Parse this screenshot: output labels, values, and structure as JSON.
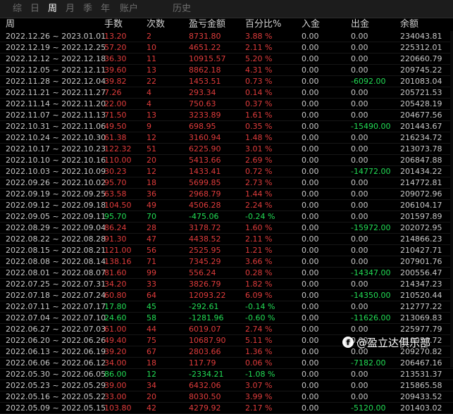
{
  "tabs": [
    {
      "label": "综"
    },
    {
      "label": "日"
    },
    {
      "label": "周",
      "active": true
    },
    {
      "label": "月"
    },
    {
      "label": "季"
    },
    {
      "label": "年"
    },
    {
      "label": "账户"
    },
    {
      "label": "历史"
    }
  ],
  "columns": {
    "week": "周",
    "hands": "手数",
    "count": "次数",
    "pnl": "盈亏金额",
    "pct": "百分比%",
    "deposit": "入金",
    "withdraw": "出金",
    "balance": "余额"
  },
  "colors": {
    "positive": "#e03c3c",
    "negative": "#22dd55",
    "neutral": "#c8c8c8"
  },
  "rows": [
    {
      "week": "2022.12.26 ~ 2023.01.01",
      "hands": "13.20",
      "count": "2",
      "pnl": "8731.80",
      "pct": "3.88 %",
      "deposit": "0.00",
      "withdraw": "0.00",
      "balance": "234043.81"
    },
    {
      "week": "2022.12.19 ~ 2022.12.25",
      "hands": "57.20",
      "count": "10",
      "pnl": "4651.22",
      "pct": "2.11 %",
      "deposit": "0.00",
      "withdraw": "0.00",
      "balance": "225312.01"
    },
    {
      "week": "2022.12.12 ~ 2022.12.18",
      "hands": "36.30",
      "count": "11",
      "pnl": "10915.57",
      "pct": "5.20 %",
      "deposit": "0.00",
      "withdraw": "0.00",
      "balance": "220660.79"
    },
    {
      "week": "2022.12.05 ~ 2022.12.11",
      "hands": "39.60",
      "count": "13",
      "pnl": "8862.18",
      "pct": "4.31 %",
      "deposit": "0.00",
      "withdraw": "0.00",
      "balance": "209745.22"
    },
    {
      "week": "2022.11.28 ~ 2022.12.04",
      "hands": "39.82",
      "count": "22",
      "pnl": "1453.51",
      "pct": "0.73 %",
      "deposit": "0.00",
      "withdraw": "-6092.00",
      "balance": "201083.04"
    },
    {
      "week": "2022.11.21 ~ 2022.11.27",
      "hands": "7.26",
      "count": "4",
      "pnl": "293.34",
      "pct": "0.14 %",
      "deposit": "0.00",
      "withdraw": "0.00",
      "balance": "205721.53"
    },
    {
      "week": "2022.11.14 ~ 2022.11.20",
      "hands": "22.00",
      "count": "4",
      "pnl": "750.63",
      "pct": "0.37 %",
      "deposit": "0.00",
      "withdraw": "0.00",
      "balance": "205428.19"
    },
    {
      "week": "2022.11.07 ~ 2022.11.13",
      "hands": "71.50",
      "count": "13",
      "pnl": "3233.89",
      "pct": "1.61 %",
      "deposit": "0.00",
      "withdraw": "0.00",
      "balance": "204677.56"
    },
    {
      "week": "2022.10.31 ~ 2022.11.06",
      "hands": "49.50",
      "count": "9",
      "pnl": "698.95",
      "pct": "0.35 %",
      "deposit": "0.00",
      "withdraw": "-15490.00",
      "balance": "201443.67"
    },
    {
      "week": "2022.10.24 ~ 2022.10.30",
      "hands": "61.38",
      "count": "12",
      "pnl": "3160.94",
      "pct": "1.48 %",
      "deposit": "0.00",
      "withdraw": "0.00",
      "balance": "216234.72"
    },
    {
      "week": "2022.10.17 ~ 2022.10.23",
      "hands": "122.32",
      "count": "51",
      "pnl": "6225.90",
      "pct": "3.01 %",
      "deposit": "0.00",
      "withdraw": "0.00",
      "balance": "213073.78"
    },
    {
      "week": "2022.10.10 ~ 2022.10.16",
      "hands": "110.00",
      "count": "20",
      "pnl": "5413.66",
      "pct": "2.69 %",
      "deposit": "0.00",
      "withdraw": "0.00",
      "balance": "206847.88"
    },
    {
      "week": "2022.10.03 ~ 2022.10.09",
      "hands": "30.23",
      "count": "12",
      "pnl": "1433.41",
      "pct": "0.72 %",
      "deposit": "0.00",
      "withdraw": "-14772.00",
      "balance": "201434.22"
    },
    {
      "week": "2022.09.26 ~ 2022.10.02",
      "hands": "95.70",
      "count": "18",
      "pnl": "5699.85",
      "pct": "2.73 %",
      "deposit": "0.00",
      "withdraw": "0.00",
      "balance": "214772.81"
    },
    {
      "week": "2022.09.19 ~ 2022.09.25",
      "hands": "63.58",
      "count": "36",
      "pnl": "2968.79",
      "pct": "1.44 %",
      "deposit": "0.00",
      "withdraw": "0.00",
      "balance": "209072.96"
    },
    {
      "week": "2022.09.12 ~ 2022.09.18",
      "hands": "104.50",
      "count": "49",
      "pnl": "4506.28",
      "pct": "2.24 %",
      "deposit": "0.00",
      "withdraw": "0.00",
      "balance": "206104.17"
    },
    {
      "week": "2022.09.05 ~ 2022.09.11",
      "hands": "95.70",
      "count": "70",
      "pnl": "-475.06",
      "pct": "-0.24 %",
      "deposit": "0.00",
      "withdraw": "0.00",
      "balance": "201597.89"
    },
    {
      "week": "2022.08.29 ~ 2022.09.04",
      "hands": "86.24",
      "count": "28",
      "pnl": "3178.72",
      "pct": "1.60 %",
      "deposit": "0.00",
      "withdraw": "-15972.00",
      "balance": "202072.95"
    },
    {
      "week": "2022.08.22 ~ 2022.08.28",
      "hands": "91.30",
      "count": "47",
      "pnl": "4438.52",
      "pct": "2.11 %",
      "deposit": "0.00",
      "withdraw": "0.00",
      "balance": "214866.23"
    },
    {
      "week": "2022.08.15 ~ 2022.08.21",
      "hands": "121.00",
      "count": "56",
      "pnl": "2525.95",
      "pct": "1.21 %",
      "deposit": "0.00",
      "withdraw": "0.00",
      "balance": "210427.71"
    },
    {
      "week": "2022.08.08 ~ 2022.08.14",
      "hands": "138.16",
      "count": "71",
      "pnl": "7345.29",
      "pct": "3.66 %",
      "deposit": "0.00",
      "withdraw": "0.00",
      "balance": "207901.76"
    },
    {
      "week": "2022.08.01 ~ 2022.08.07",
      "hands": "81.60",
      "count": "99",
      "pnl": "556.24",
      "pct": "0.28 %",
      "deposit": "0.00",
      "withdraw": "-14347.00",
      "balance": "200556.47"
    },
    {
      "week": "2022.07.25 ~ 2022.07.31",
      "hands": "34.20",
      "count": "33",
      "pnl": "3826.79",
      "pct": "1.82 %",
      "deposit": "0.00",
      "withdraw": "0.00",
      "balance": "214347.23"
    },
    {
      "week": "2022.07.18 ~ 2022.07.24",
      "hands": "60.80",
      "count": "64",
      "pnl": "12093.22",
      "pct": "6.09 %",
      "deposit": "0.00",
      "withdraw": "-14350.00",
      "balance": "210520.44"
    },
    {
      "week": "2022.07.11 ~ 2022.07.17",
      "hands": "17.80",
      "count": "45",
      "pnl": "-292.61",
      "pct": "-0.14 %",
      "deposit": "0.00",
      "withdraw": "0.00",
      "balance": "212777.22"
    },
    {
      "week": "2022.07.04 ~ 2022.07.10",
      "hands": "24.60",
      "count": "58",
      "pnl": "-1281.96",
      "pct": "-0.60 %",
      "deposit": "0.00",
      "withdraw": "-11626.00",
      "balance": "213069.83"
    },
    {
      "week": "2022.06.27 ~ 2022.07.03",
      "hands": "61.00",
      "count": "44",
      "pnl": "6019.07",
      "pct": "2.74 %",
      "deposit": "0.00",
      "withdraw": "0.00",
      "balance": "225977.79"
    },
    {
      "week": "2022.06.20 ~ 2022.06.26",
      "hands": "49.40",
      "count": "75",
      "pnl": "10687.90",
      "pct": "5.11 %",
      "deposit": "0.00",
      "withdraw": "0.00",
      "balance": "219958.72"
    },
    {
      "week": "2022.06.13 ~ 2022.06.19",
      "hands": "39.20",
      "count": "67",
      "pnl": "2803.66",
      "pct": "1.36 %",
      "deposit": "0.00",
      "withdraw": "0.00",
      "balance": "209270.82"
    },
    {
      "week": "2022.06.06 ~ 2022.06.12",
      "hands": "34.00",
      "count": "18",
      "pnl": "117.79",
      "pct": "0.06 %",
      "deposit": "0.00",
      "withdraw": "-7182.00",
      "balance": "206467.16"
    },
    {
      "week": "2022.05.30 ~ 2022.06.05",
      "hands": "86.00",
      "count": "12",
      "pnl": "-2334.21",
      "pct": "-1.08 %",
      "deposit": "0.00",
      "withdraw": "0.00",
      "balance": "213531.37"
    },
    {
      "week": "2022.05.23 ~ 2022.05.29",
      "hands": "39.00",
      "count": "34",
      "pnl": "6432.06",
      "pct": "3.07 %",
      "deposit": "0.00",
      "withdraw": "0.00",
      "balance": "215865.58"
    },
    {
      "week": "2022.05.16 ~ 2022.05.22",
      "hands": "33.00",
      "count": "20",
      "pnl": "8030.50",
      "pct": "3.99 %",
      "deposit": "0.00",
      "withdraw": "0.00",
      "balance": "209433.52"
    },
    {
      "week": "2022.05.09 ~ 2022.05.15",
      "hands": "103.80",
      "count": "42",
      "pnl": "4279.92",
      "pct": "2.17 %",
      "deposit": "0.00",
      "withdraw": "-5120.00",
      "balance": "201403.02"
    }
  ],
  "watermark": {
    "logo": "f",
    "text": "@盈立达俱乐部"
  }
}
